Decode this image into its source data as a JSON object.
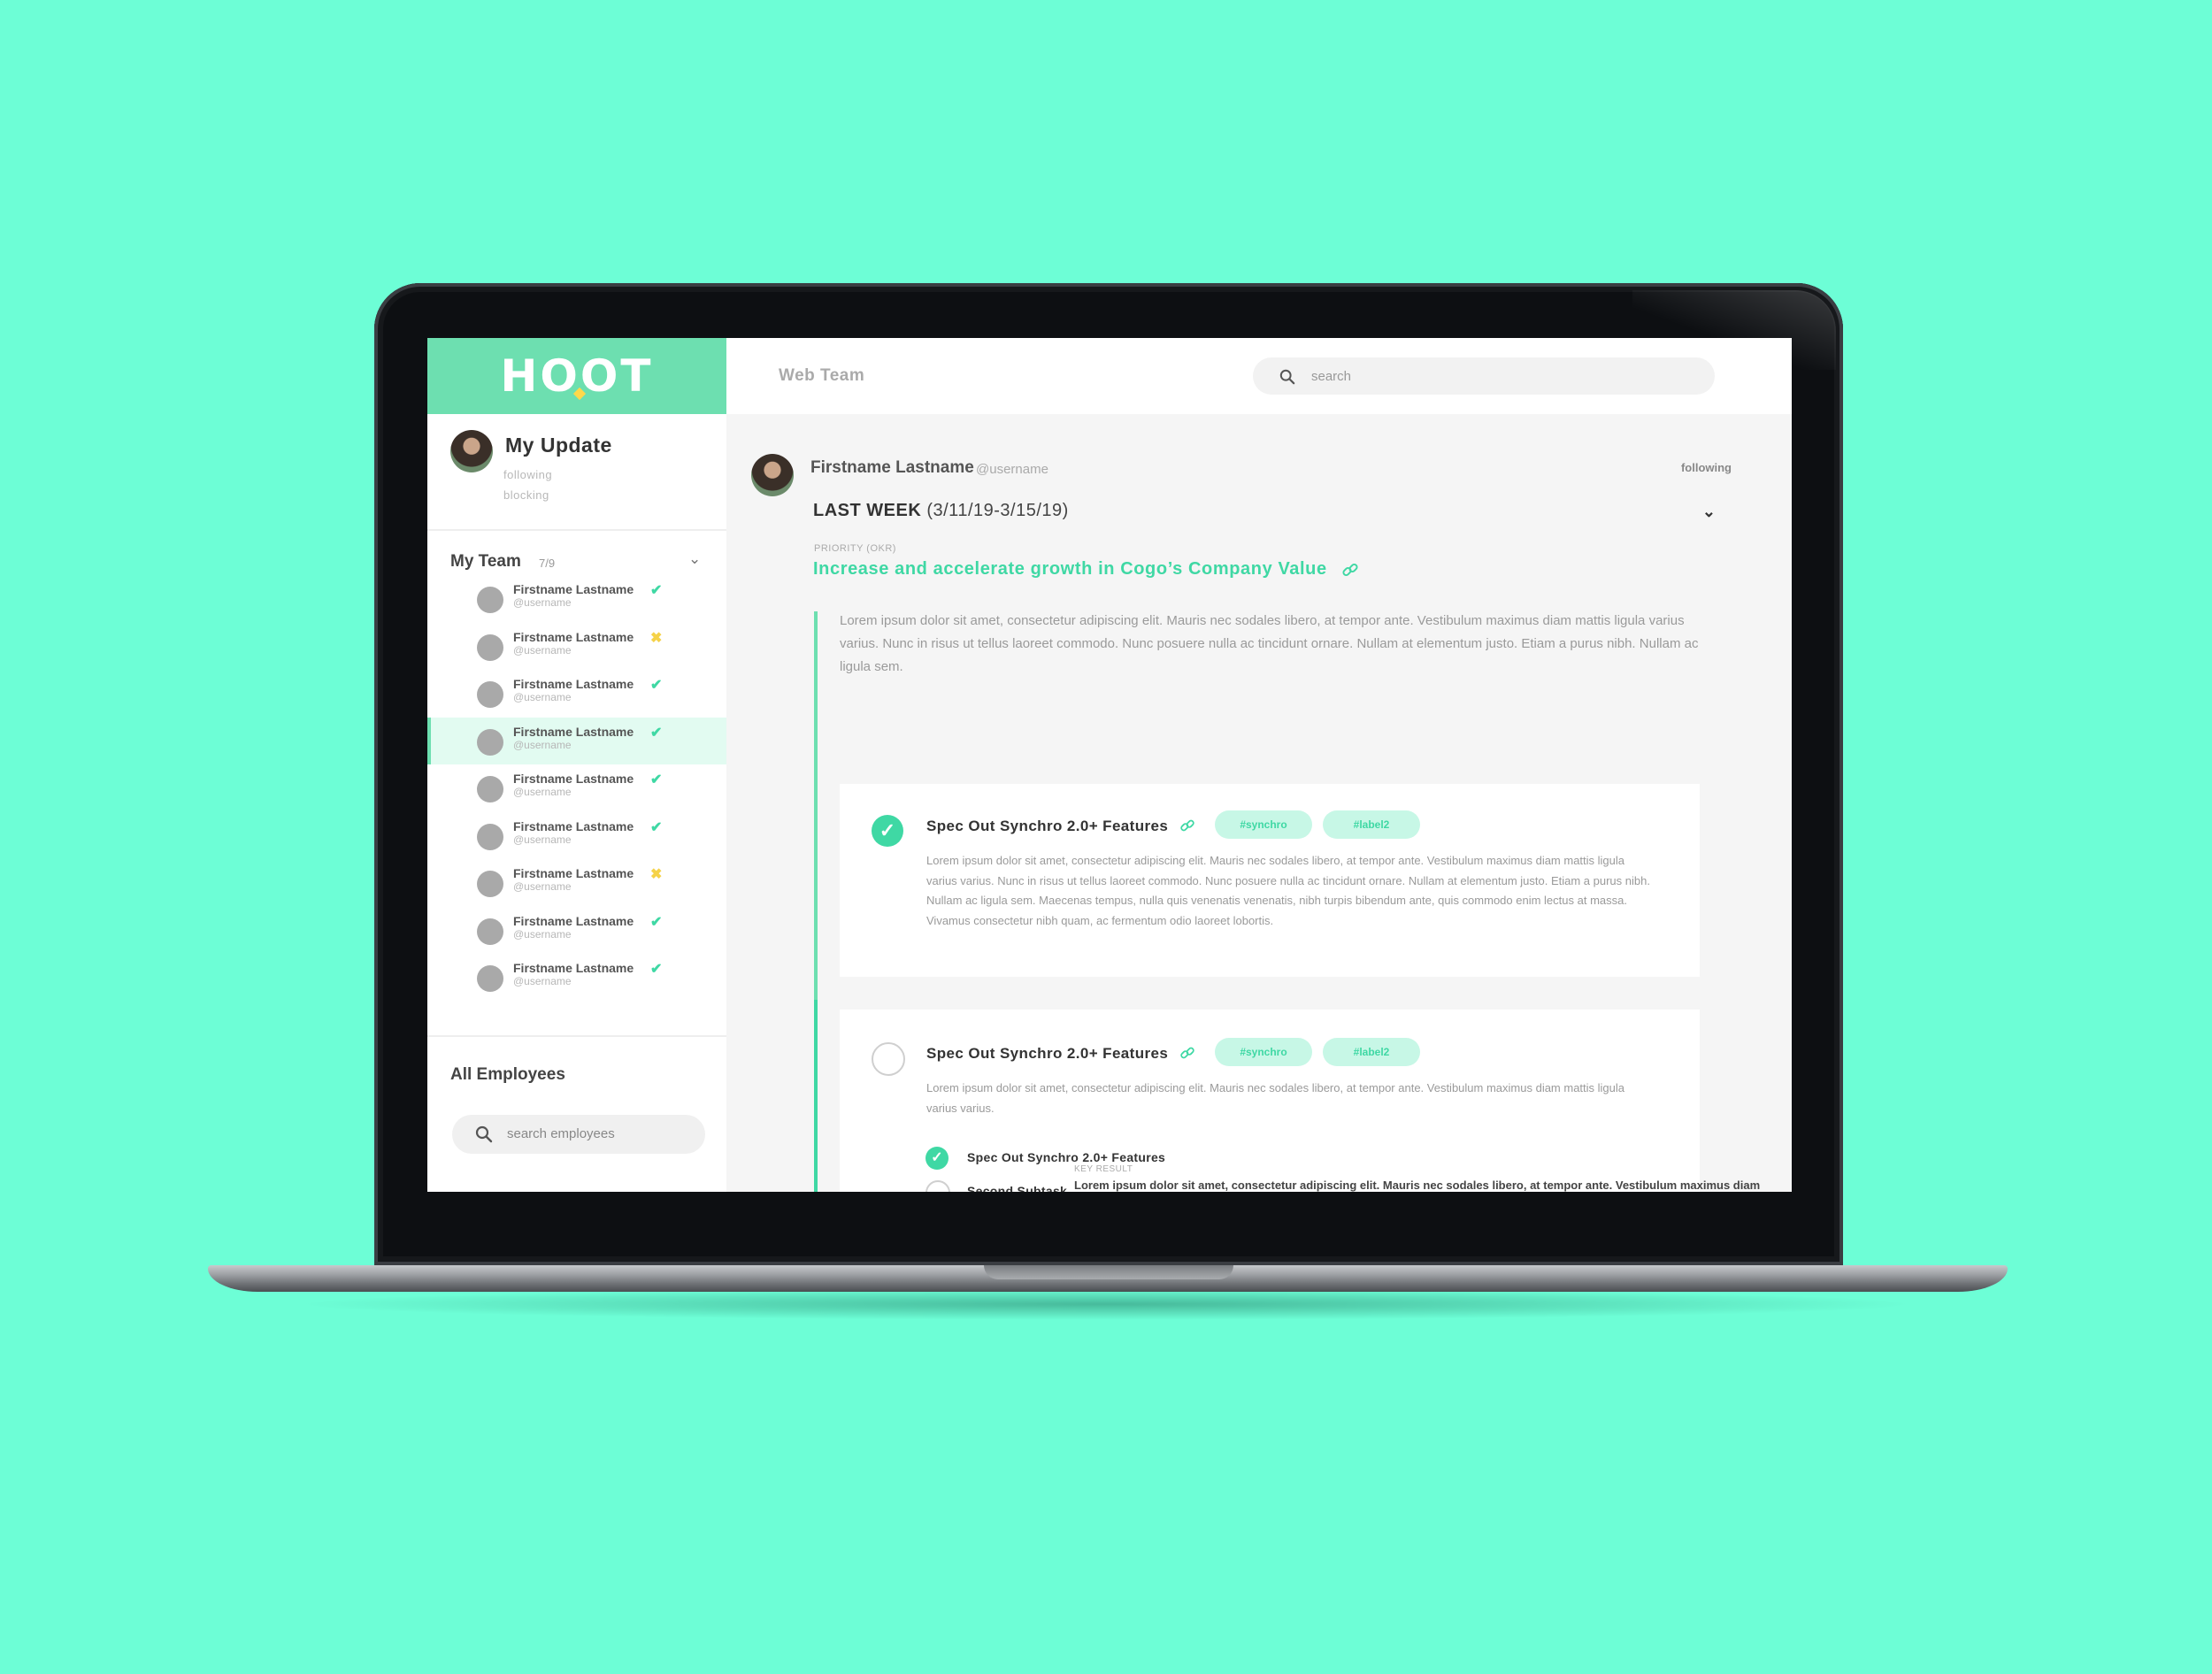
{
  "app": {
    "logo": "HOOT"
  },
  "sidebar": {
    "me": {
      "title": "My Update",
      "following": "following",
      "blocking": "blocking"
    },
    "team": {
      "title": "My Team",
      "count": "7/9",
      "members": [
        {
          "name": "Firstname Lastname",
          "username": "@username",
          "status": "✔"
        },
        {
          "name": "Firstname Lastname",
          "username": "@username",
          "status": "✖"
        },
        {
          "name": "Firstname Lastname",
          "username": "@username",
          "status": "✔"
        },
        {
          "name": "Firstname Lastname",
          "username": "@username",
          "status": "✔"
        },
        {
          "name": "Firstname Lastname",
          "username": "@username",
          "status": "✔"
        },
        {
          "name": "Firstname Lastname",
          "username": "@username",
          "status": "✔"
        },
        {
          "name": "Firstname Lastname",
          "username": "@username",
          "status": "✖"
        },
        {
          "name": "Firstname Lastname",
          "username": "@username",
          "status": "✔"
        },
        {
          "name": "Firstname Lastname",
          "username": "@username",
          "status": "✔"
        }
      ]
    },
    "employees": {
      "title": "All Employees",
      "search_placeholder": "search employees"
    }
  },
  "header": {
    "team_name": "Web Team",
    "search_placeholder": "search"
  },
  "post": {
    "author": "Firstname Lastname",
    "username": "@username",
    "following": "following",
    "week_label": "LAST WEEK",
    "week_range": "(3/11/19-3/15/19)",
    "priority_label": "PRIORITY (OKR)",
    "priority_title": "Increase and accelerate growth in Cogo’s Company Value",
    "priority_body": "Lorem ipsum dolor sit amet, consectetur adipiscing elit. Mauris nec sodales libero, at tempor ante. Vestibulum maximus diam mattis ligula varius varius. Nunc in risus ut tellus laoreet commodo. Nunc posuere nulla ac tincidunt ornare. Nullam at elementum justo. Etiam a purus nibh. Nullam ac ligula sem.",
    "tasks": [
      {
        "title": "Spec Out Synchro 2.0+ Features",
        "done": true,
        "tags": [
          "#synchro",
          "#label2"
        ],
        "body": "Lorem ipsum dolor sit amet, consectetur adipiscing elit. Mauris nec sodales libero, at tempor ante. Vestibulum maximus diam mattis ligula varius varius. Nunc in risus ut tellus laoreet commodo. Nunc posuere nulla ac tincidunt ornare. Nullam at elementum justo. Etiam a purus nibh. Nullam ac ligula sem. Maecenas tempus, nulla quis venenatis venenatis, nibh turpis bibendum ante, quis commodo enim lectus at massa. Vivamus consectetur nibh quam, ac fermentum odio laoreet lobortis."
      },
      {
        "title": "Spec Out Synchro 2.0+ Features",
        "done": false,
        "tags": [
          "#synchro",
          "#label2"
        ],
        "body": "Lorem ipsum dolor sit amet, consectetur adipiscing elit. Mauris nec sodales libero, at tempor ante. Vestibulum maximus diam mattis ligula varius varius.",
        "subtasks": [
          {
            "label": "Spec Out Synchro 2.0+ Features",
            "done": true
          },
          {
            "label": "Second Subtask",
            "done": false
          }
        ],
        "key_result_label": "KEY RESULT",
        "key_result_text": "Lorem ipsum dolor sit amet, consectetur adipiscing elit. Mauris nec sodales libero, at tempor ante. Vestibulum maximus diam"
      }
    ]
  },
  "colors": {
    "background": "#6dfed6",
    "accent": "#3fd8a4",
    "logo_bar": "#6ddfb0",
    "warning": "#f5d248"
  }
}
